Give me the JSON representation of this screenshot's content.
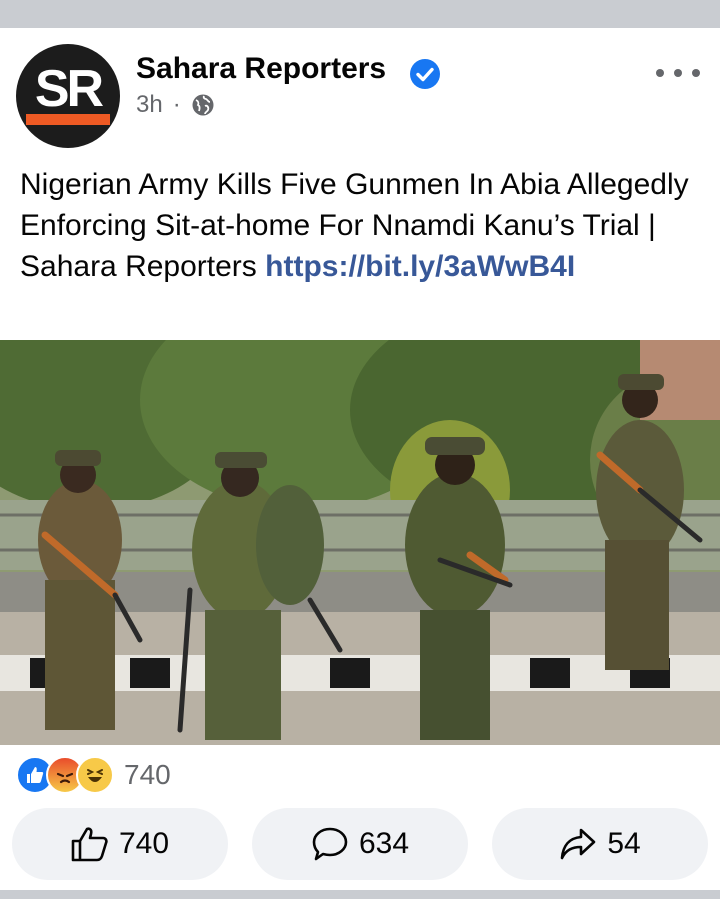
{
  "post": {
    "author": "Sahara Reporters",
    "avatar_text": "SR",
    "time": "3h",
    "separator": "·",
    "text_main": "Nigerian Army Kills Five Gunmen In Abia Allegedly Enforcing Sit-at-home For Nnamdi Kanu’s Trial | Sahara Reporters ",
    "link": "https://bit.ly/3aWwB4I"
  },
  "reactions": {
    "icons": [
      "like-icon",
      "angry-icon",
      "haha-icon"
    ],
    "count": "740"
  },
  "actions": {
    "like_count": "740",
    "comment_count": "634",
    "share_count": "54"
  },
  "colors": {
    "verified": "#1877f2",
    "link": "#385898",
    "avatar_stripe": "#ee5a24"
  }
}
